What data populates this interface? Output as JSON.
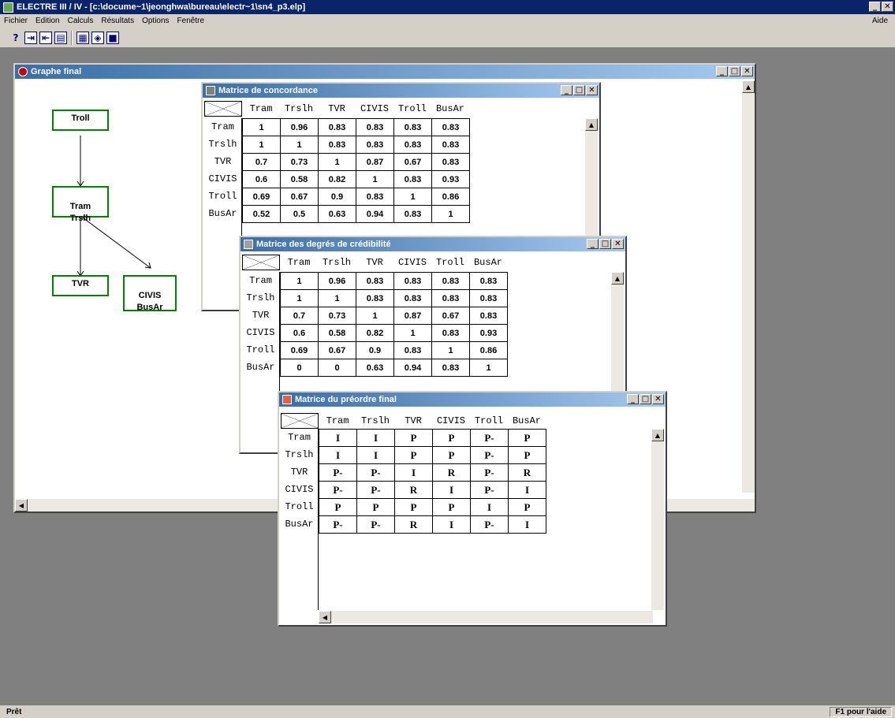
{
  "app": {
    "title": "ELECTRE  III / IV - [c:\\docume~1\\jeonghwa\\bureau\\electr~1\\sn4_p3.elp]"
  },
  "menu": {
    "items": [
      "Fichier",
      "Edition",
      "Calculs",
      "Résultats",
      "Options",
      "Fenêtre"
    ],
    "aide": "Aide"
  },
  "toolbar": {
    "help": "?"
  },
  "graph": {
    "title": "Graphe final",
    "nodes": [
      "Troll",
      "Tram\nTrslh",
      "TVR",
      "CIVIS\nBusAr"
    ]
  },
  "alternatives": [
    "Tram",
    "Trslh",
    "TVR",
    "CIVIS",
    "Troll",
    "BusAr"
  ],
  "concordance": {
    "title": "Matrice de concordance",
    "rows": [
      [
        "1",
        "0.96",
        "0.83",
        "0.83",
        "0.83",
        "0.83"
      ],
      [
        "1",
        "1",
        "0.83",
        "0.83",
        "0.83",
        "0.83"
      ],
      [
        "0.7",
        "0.73",
        "1",
        "0.87",
        "0.67",
        "0.83"
      ],
      [
        "0.6",
        "0.58",
        "0.82",
        "1",
        "0.83",
        "0.93"
      ],
      [
        "0.69",
        "0.67",
        "0.9",
        "0.83",
        "1",
        "0.86"
      ],
      [
        "0.52",
        "0.5",
        "0.63",
        "0.94",
        "0.83",
        "1"
      ]
    ]
  },
  "credibility": {
    "title": "Matrice des degrés de crédibilité",
    "rows": [
      [
        "1",
        "0.96",
        "0.83",
        "0.83",
        "0.83",
        "0.83"
      ],
      [
        "1",
        "1",
        "0.83",
        "0.83",
        "0.83",
        "0.83"
      ],
      [
        "0.7",
        "0.73",
        "1",
        "0.87",
        "0.67",
        "0.83"
      ],
      [
        "0.6",
        "0.58",
        "0.82",
        "1",
        "0.83",
        "0.93"
      ],
      [
        "0.69",
        "0.67",
        "0.9",
        "0.83",
        "1",
        "0.86"
      ],
      [
        "0",
        "0",
        "0.63",
        "0.94",
        "0.83",
        "1"
      ]
    ]
  },
  "preorder": {
    "title": "Matrice du préordre final",
    "rows": [
      [
        "I",
        "I",
        "P",
        "P",
        "P-",
        "P"
      ],
      [
        "I",
        "I",
        "P",
        "P",
        "P-",
        "P"
      ],
      [
        "P-",
        "P-",
        "I",
        "R",
        "P-",
        "R"
      ],
      [
        "P-",
        "P-",
        "R",
        "I",
        "P-",
        "I"
      ],
      [
        "P",
        "P",
        "P",
        "P",
        "I",
        "P"
      ],
      [
        "P-",
        "P-",
        "R",
        "I",
        "P-",
        "I"
      ]
    ]
  },
  "status": {
    "left": "Prêt",
    "right": "F1 pour l'aide"
  },
  "colors": {
    "titlebar": "#0a246a",
    "mdi_title": "#3a6ea5",
    "node_border": "#008000",
    "desktop": "#808080"
  }
}
